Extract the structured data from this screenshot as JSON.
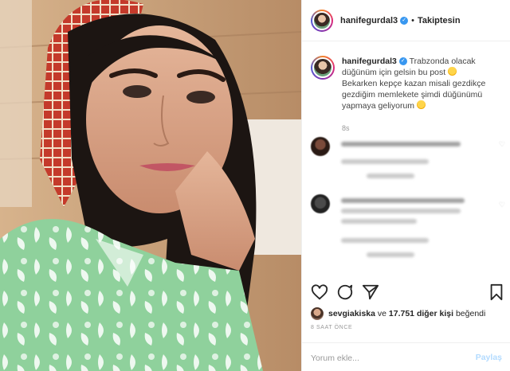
{
  "header": {
    "username": "hanifegurdal3",
    "dot": "•",
    "follow_status": "Takiptesin"
  },
  "caption": {
    "username": "hanifegurdal3",
    "line1": " Trabzonda olacak düğünüm için gelsin bu post ",
    "line2": "Bekarken kepçe kazan misali gezdikçe gezdiğim memlekete şimdi düğünümü yapmaya geliyorum ",
    "time": "8s"
  },
  "actions": {
    "icons": [
      "heart-icon",
      "comment-icon",
      "share-icon",
      "bookmark-icon"
    ]
  },
  "likes": {
    "user": "sevgiakiska",
    "middle": " ve ",
    "count": "17.751 diğer kişi",
    "suffix": " beğendi"
  },
  "timestamp": "8 SAAT ÖNCE",
  "comment_box": {
    "placeholder": "Yorum ekle...",
    "submit_label": "Paylaş"
  },
  "colors": {
    "verified": "#3897f0",
    "post_disabled": "#b3dbff"
  }
}
